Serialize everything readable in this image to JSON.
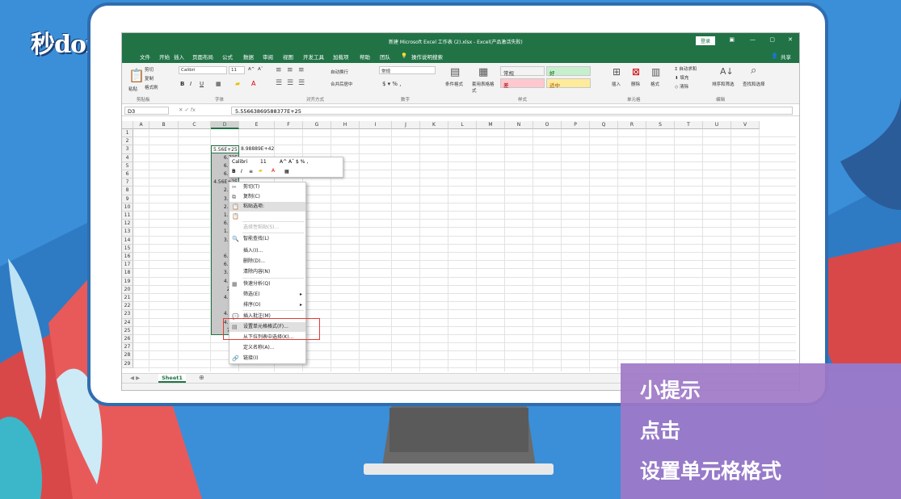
{
  "watermark": {
    "logo": "秒dong视频"
  },
  "excel": {
    "title": "新建 Microsoft Excel 工作表 (2).xlsx - Excel(产品激活失败)",
    "login": "登录",
    "share": "共享",
    "tell_me": "操作说明搜索",
    "menu": [
      "文件",
      "开始",
      "插入",
      "页面布局",
      "公式",
      "数据",
      "审阅",
      "视图",
      "开发工具",
      "加载项",
      "帮助",
      "团队"
    ],
    "ribbon": {
      "font_name": "Calibri",
      "font_size": "11",
      "number_format": "常规",
      "cut": "剪切",
      "copy": "复制",
      "format_painter": "格式刷",
      "paste": "粘贴",
      "wrap_text": "自动换行",
      "merge_center": "合并后居中",
      "cond_format": "条件格式",
      "table_format": "套用表格格式",
      "styles": [
        {
          "label": "常规",
          "bg": "#ffffff",
          "fg": "#000000"
        },
        {
          "label": "好",
          "bg": "#c6efce",
          "fg": "#006100"
        },
        {
          "label": "差",
          "bg": "#ffc7ce",
          "fg": "#9c0006"
        },
        {
          "label": "适中",
          "bg": "#ffeb9c",
          "fg": "#9c5700"
        }
      ],
      "insert": "插入",
      "delete": "删除",
      "format": "格式",
      "autosum": "自动求和",
      "fill": "填充",
      "clear": "清除",
      "sort_filter": "排序和筛选",
      "find_select": "查找和选择",
      "groups": [
        "剪贴板",
        "字体",
        "对齐方式",
        "数字",
        "样式",
        "单元格",
        "编辑"
      ]
    },
    "name_box": "D3",
    "formula": "5.55663869588377E+25",
    "columns": [
      "A",
      "B",
      "C",
      "D",
      "E",
      "F",
      "G",
      "H",
      "I",
      "J",
      "K",
      "L",
      "M",
      "N",
      "O",
      "P",
      "Q",
      "R",
      "S",
      "T",
      "U",
      "V"
    ],
    "rows": [
      "1",
      "2",
      "3",
      "4",
      "5",
      "6",
      "7",
      "8",
      "9",
      "10",
      "11",
      "12",
      "13",
      "14",
      "15",
      "16",
      "17",
      "18",
      "19",
      "20",
      "21",
      "22",
      "23",
      "24",
      "25",
      "26",
      "27",
      "28",
      "29"
    ],
    "d_values": [
      "5.56E+25",
      "6.72E",
      "6.39E",
      "6.82E",
      "4.56E+25",
      "2.89E",
      "3.69E",
      "2.57E",
      "1.11E",
      "6.17E",
      "1.16E",
      "3.23E",
      "5E",
      "6.05E",
      "6.72E",
      "3.85E",
      "4.16E",
      "2.7E",
      "4.82E",
      "6E",
      "4.37E",
      "4.22E",
      "7.6E"
    ],
    "e3_value": "8.98889E+42",
    "mini_toolbar": {
      "font": "Calibri",
      "size": "11"
    },
    "context_menu": [
      {
        "label": "剪切(T)",
        "icon": "✂",
        "disabled": false
      },
      {
        "label": "复制(C)",
        "icon": "⧉",
        "disabled": false
      },
      {
        "label": "粘贴选项:",
        "icon": "📋",
        "disabled": false,
        "highlight": true
      },
      {
        "label": "",
        "icon": "📋",
        "disabled": false
      },
      {
        "label": "选择性粘贴(S)...",
        "icon": "",
        "disabled": true
      },
      {
        "label": "智能查找(L)",
        "icon": "🔍",
        "disabled": false
      },
      {
        "label": "插入(I)...",
        "icon": "",
        "disabled": false
      },
      {
        "label": "删除(D)...",
        "icon": "",
        "disabled": false
      },
      {
        "label": "清除内容(N)",
        "icon": "",
        "disabled": false
      },
      {
        "label": "快速分析(Q)",
        "icon": "▦",
        "disabled": false
      },
      {
        "label": "筛选(E)",
        "icon": "",
        "disabled": false,
        "arrow": true
      },
      {
        "label": "排序(O)",
        "icon": "",
        "disabled": false,
        "arrow": true
      },
      {
        "label": "插入批注(M)",
        "icon": "💬",
        "disabled": false
      },
      {
        "label": "设置单元格格式(F)...",
        "icon": "▤",
        "disabled": false,
        "highlight": true
      },
      {
        "label": "从下拉列表中选择(K)...",
        "icon": "",
        "disabled": false
      },
      {
        "label": "定义名称(A)...",
        "icon": "",
        "disabled": false
      },
      {
        "label": "链接(I)",
        "icon": "🔗",
        "disabled": false
      }
    ],
    "sheet_tab": "Sheet1",
    "accent": "#217346"
  },
  "tip": {
    "l1": "小提示",
    "l2": "点击",
    "l3": "设置单元格格式"
  }
}
